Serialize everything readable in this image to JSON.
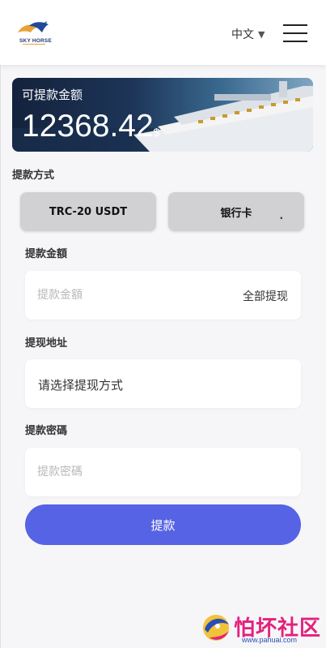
{
  "header": {
    "logo_text": "SKY HORSE",
    "language": "中文",
    "language_arrow": "▼"
  },
  "balance": {
    "title": "可提款金额",
    "amount": "12368.42",
    "currency_symbol": "$"
  },
  "withdraw_method": {
    "label": "提款方式",
    "options": [
      "TRC-20 USDT",
      "银行卡"
    ],
    "bank_suffix": "."
  },
  "amount_field": {
    "label": "提款金額",
    "placeholder": "提款金額",
    "all_button": "全部提现"
  },
  "address_field": {
    "label": "提现地址",
    "value": "请选择提现方式"
  },
  "password_field": {
    "label": "提款密碼",
    "placeholder": "提款密碼"
  },
  "submit_label": "提款",
  "watermark": {
    "text": "怕坏社区",
    "url": "www.pahuai.com"
  },
  "colors": {
    "accent": "#5663e4",
    "method_button": "#d1d1d3",
    "background": "#f6f6f8"
  }
}
